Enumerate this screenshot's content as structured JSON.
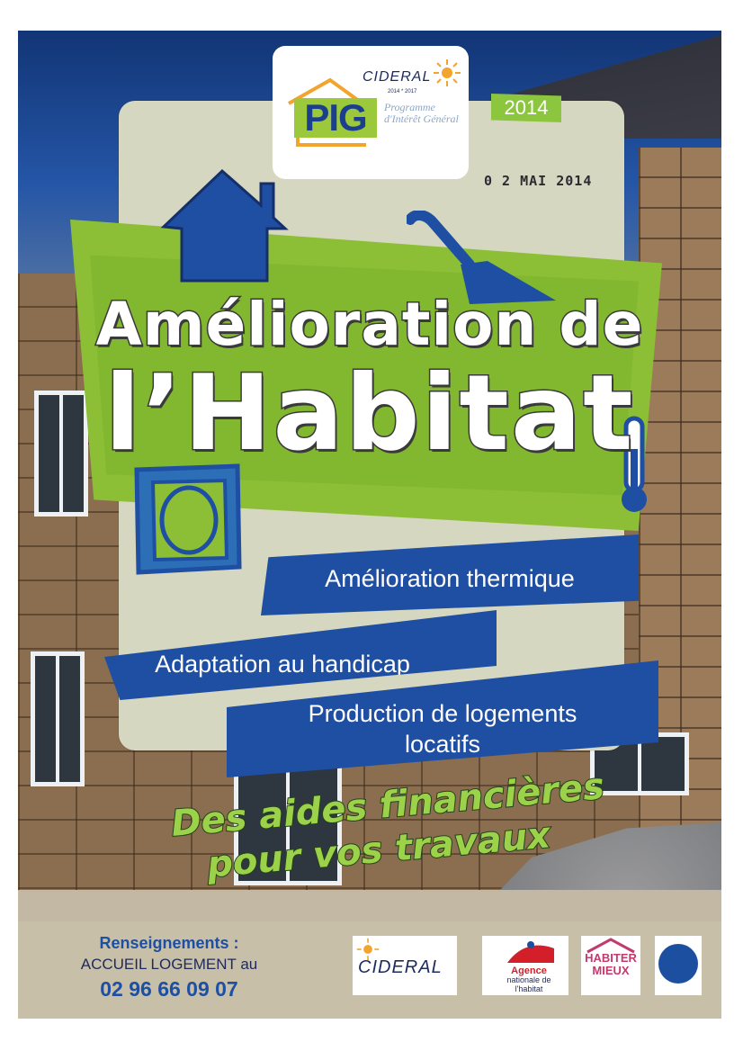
{
  "header": {
    "logo_pig": "PIG",
    "logo_cideral": "CIDERAL",
    "logo_years": "2014 * 2017",
    "logo_programme": "Programme d'Intérêt Général",
    "year_badge": "2014",
    "stamp": "0 2 MAI 2014"
  },
  "title": {
    "line1": "Amélioration de",
    "line2": "l’Habitat"
  },
  "themes": {
    "item1": "Amélioration thermique",
    "item2": "Adaptation au handicap",
    "item3_line1": "Production de logements",
    "item3_line2": "locatifs"
  },
  "slogan": {
    "line1": "Des aides financières",
    "line2": "pour vos travaux"
  },
  "footer": {
    "info_label": "Renseignements :",
    "info_line": "ACCUEIL LOGEMENT au",
    "phone": "02 96 66 09 07"
  },
  "partners": {
    "cideral": "CIDERAL",
    "anah_name": "Agence",
    "anah_sub": "nationale de l'habitat",
    "habiter_line1": "HABITER",
    "habiter_line2": "MIEUX"
  },
  "colors": {
    "green": "#8cbf36",
    "blue": "#1f4fa3",
    "slogan_green": "#9cd14a"
  }
}
